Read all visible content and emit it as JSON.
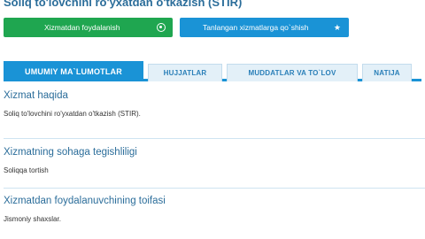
{
  "page": {
    "title": "Soliq to'lovchini ro'yxatdan o'tkazish (STIR)"
  },
  "actions": {
    "use_service_label": "Xizmatdan foydalanish",
    "use_service_icon": "target-circle-icon",
    "favorite_label": "Tanlangan xizmatlarga qo`shish",
    "favorite_icon": "star-icon",
    "use_service_color": "#1fa650",
    "favorite_color": "#1a93d6"
  },
  "tabs": [
    {
      "label": "UMUMIY MA`LUMOTLAR",
      "active": true
    },
    {
      "label": "HUJJATLAR",
      "active": false
    },
    {
      "label": "MUDDATLAR VA TO`LOV",
      "active": false
    },
    {
      "label": "NATIJA",
      "active": false
    }
  ],
  "sections": [
    {
      "heading": "Xizmat haqida",
      "text": "Soliq to'lovchini ro'yxatdan o'tkazish (STIR)."
    },
    {
      "heading": "Xizmatning sohaga tegishliligi",
      "text": "Soliqqa tortish"
    },
    {
      "heading": "Xizmatdan foydalanuvchining toifasi",
      "text": "Jismoniy shaxslar."
    }
  ]
}
